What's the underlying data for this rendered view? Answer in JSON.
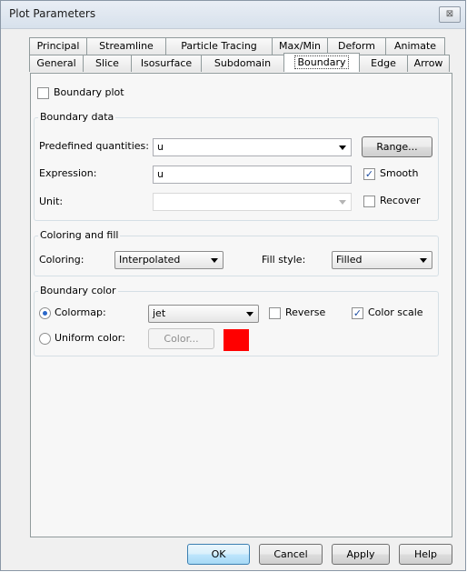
{
  "window": {
    "title": "Plot Parameters",
    "close_glyph": "⊠"
  },
  "tabs_top": [
    "Principal",
    "Streamline",
    "Particle Tracing",
    "Max/Min",
    "Deform",
    "Animate"
  ],
  "tabs_bottom": [
    "General",
    "Slice",
    "Isosurface",
    "Subdomain",
    "Boundary",
    "Edge",
    "Arrow"
  ],
  "active_tab": "Boundary",
  "boundary_plot": {
    "label": "Boundary plot",
    "checked": false
  },
  "boundary_data": {
    "title": "Boundary data",
    "predefined_label": "Predefined quantities:",
    "predefined_value": "u",
    "range_button": "Range...",
    "expression_label": "Expression:",
    "expression_value": "u",
    "smooth_label": "Smooth",
    "smooth_checked": true,
    "unit_label": "Unit:",
    "unit_value": "",
    "recover_label": "Recover",
    "recover_checked": false
  },
  "coloring_fill": {
    "title": "Coloring and fill",
    "coloring_label": "Coloring:",
    "coloring_value": "Interpolated",
    "fill_label": "Fill style:",
    "fill_value": "Filled"
  },
  "boundary_color": {
    "title": "Boundary color",
    "colormap_label": "Colormap:",
    "colormap_selected": true,
    "colormap_value": "jet",
    "reverse_label": "Reverse",
    "reverse_checked": false,
    "color_scale_label": "Color scale",
    "color_scale_checked": true,
    "uniform_label": "Uniform color:",
    "uniform_selected": false,
    "color_button": "Color...",
    "uniform_color": "#ff0000"
  },
  "footer": {
    "ok": "OK",
    "cancel": "Cancel",
    "apply": "Apply",
    "help": "Help"
  },
  "icons": {
    "check": "✓"
  }
}
